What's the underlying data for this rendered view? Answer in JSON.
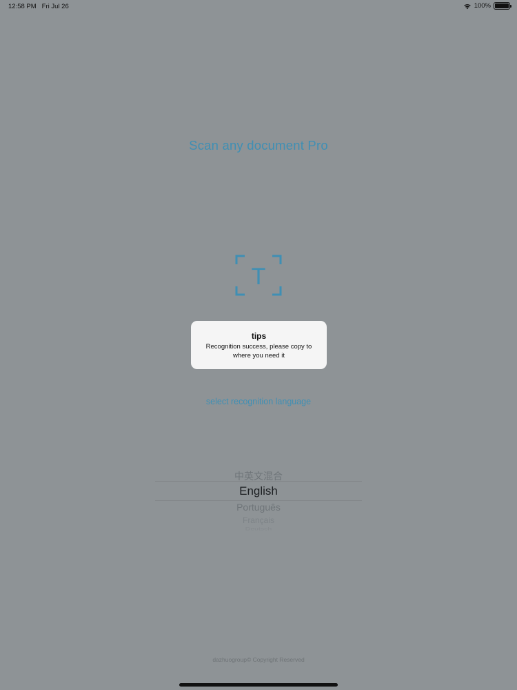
{
  "status_bar": {
    "time": "12:58 PM",
    "date": "Fri Jul 26",
    "battery": "100%",
    "battery_level": 1.0
  },
  "app": {
    "title": "Scan any document Pro",
    "scan_icon_letter": "T"
  },
  "language": {
    "prompt": "select recognition language",
    "options": [
      "中英文混合",
      "English",
      "Português",
      "Français",
      "Deutsch"
    ],
    "selected": "English"
  },
  "alert": {
    "title": "tips",
    "message": "Recognition success, please copy to where you need it"
  },
  "footer": {
    "copyright": "dazhuogroup© Copyright Reserved"
  },
  "colors": {
    "accent": "#3f8fb4",
    "dim_background": "#8e9396",
    "alert_background": "#f5f5f5"
  }
}
